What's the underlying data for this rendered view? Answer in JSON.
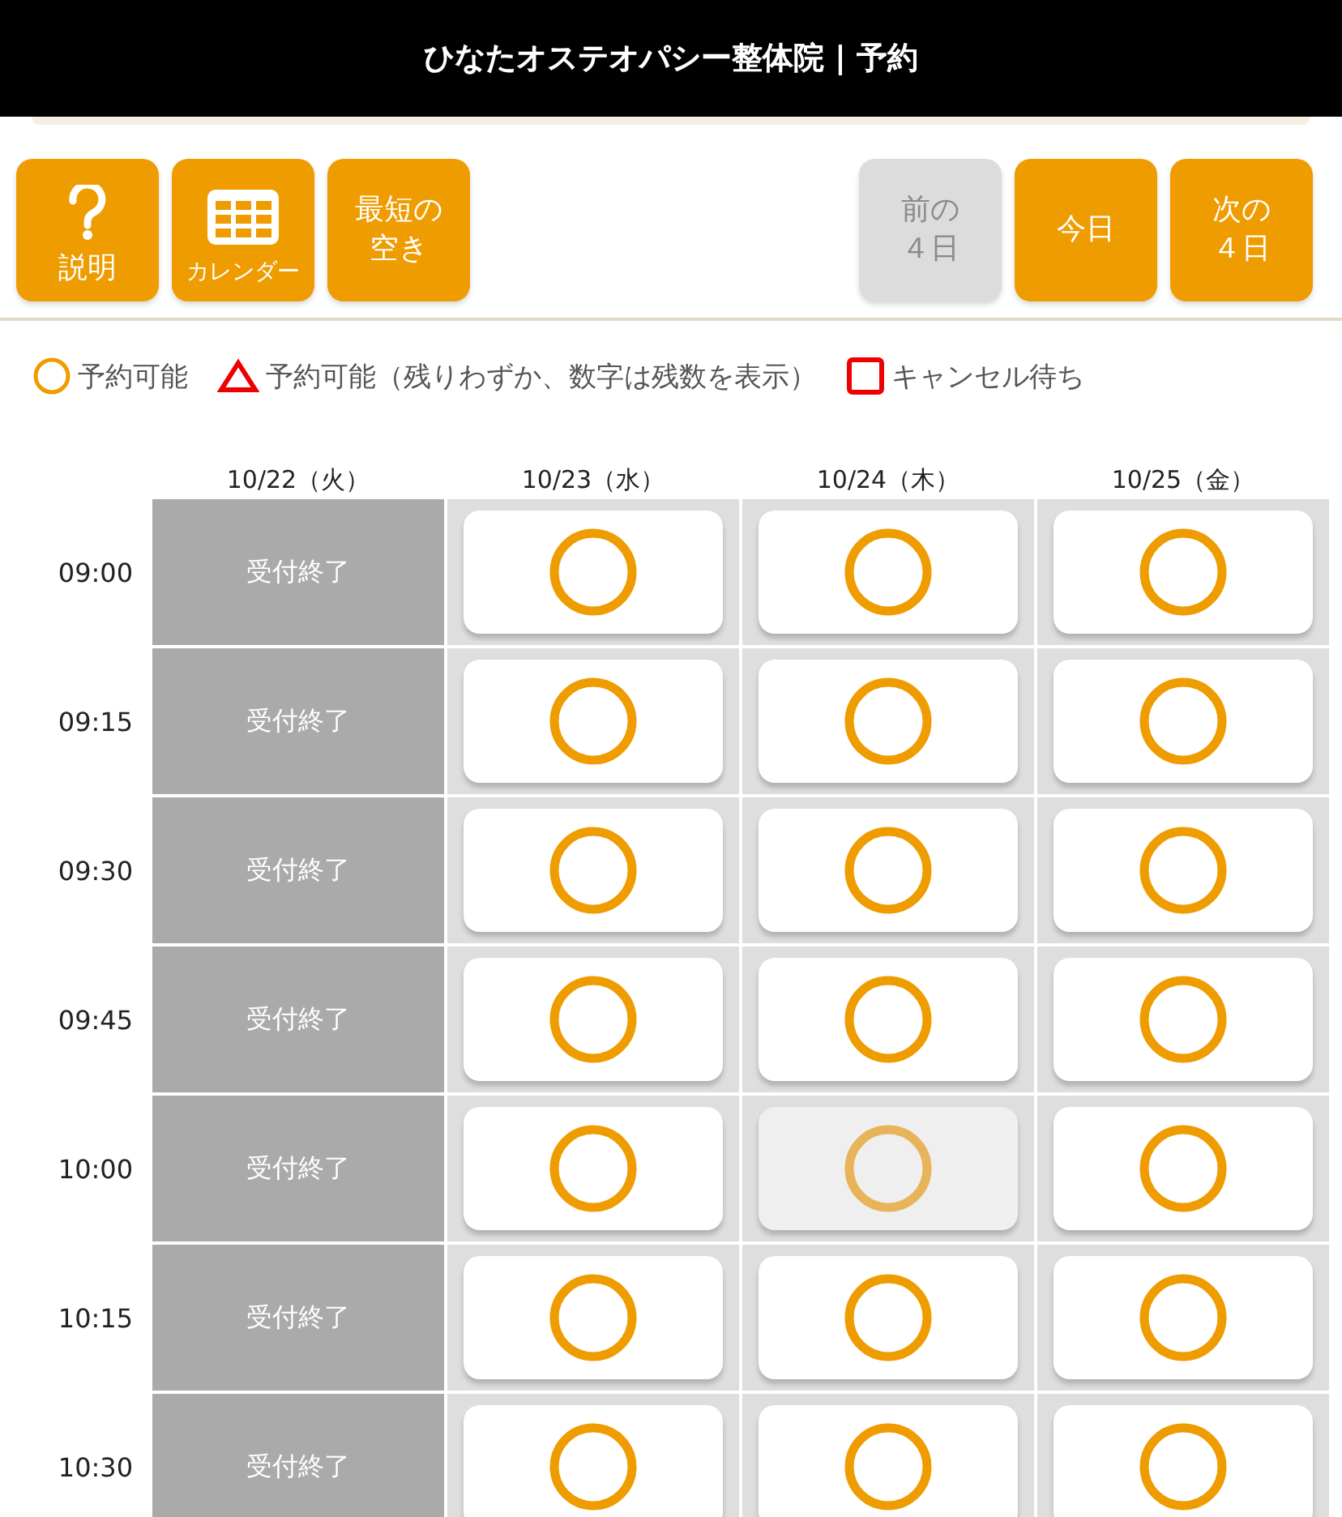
{
  "header": {
    "title": "ひなたオステオパシー整体院 | 予約"
  },
  "left_buttons": [
    {
      "kind": "help",
      "label": "説明",
      "disabled": false
    },
    {
      "kind": "calendar",
      "label": "カレンダー",
      "disabled": false
    },
    {
      "kind": "text",
      "label": "最短の空き",
      "disabled": false
    }
  ],
  "right_buttons": [
    {
      "kind": "text",
      "label": "前の４日",
      "disabled": true
    },
    {
      "kind": "text",
      "label": "今日",
      "disabled": false
    },
    {
      "kind": "text",
      "label": "次の４日",
      "disabled": false
    }
  ],
  "legend": [
    {
      "kind": "circle",
      "label": "予約可能"
    },
    {
      "kind": "triangle",
      "label": "予約可能（残りわずか、数字は残数を表示）"
    },
    {
      "kind": "square",
      "label": "キャンセル待ち"
    }
  ],
  "columns": [
    "10/22（火）",
    "10/23（水）",
    "10/24（木）",
    "10/25（金）"
  ],
  "rows": [
    {
      "time": "09:00",
      "cells": [
        {
          "kind": "closed",
          "text": "受付終了"
        },
        {
          "kind": "open",
          "selected": false
        },
        {
          "kind": "open",
          "selected": false
        },
        {
          "kind": "open",
          "selected": false
        }
      ]
    },
    {
      "time": "09:15",
      "cells": [
        {
          "kind": "closed",
          "text": "受付終了"
        },
        {
          "kind": "open",
          "selected": false
        },
        {
          "kind": "open",
          "selected": false
        },
        {
          "kind": "open",
          "selected": false
        }
      ]
    },
    {
      "time": "09:30",
      "cells": [
        {
          "kind": "closed",
          "text": "受付終了"
        },
        {
          "kind": "open",
          "selected": false
        },
        {
          "kind": "open",
          "selected": false
        },
        {
          "kind": "open",
          "selected": false
        }
      ]
    },
    {
      "time": "09:45",
      "cells": [
        {
          "kind": "closed",
          "text": "受付終了"
        },
        {
          "kind": "open",
          "selected": false
        },
        {
          "kind": "open",
          "selected": false
        },
        {
          "kind": "open",
          "selected": false
        }
      ]
    },
    {
      "time": "10:00",
      "cells": [
        {
          "kind": "closed",
          "text": "受付終了"
        },
        {
          "kind": "open",
          "selected": false
        },
        {
          "kind": "open",
          "selected": true
        },
        {
          "kind": "open",
          "selected": false
        }
      ]
    },
    {
      "time": "10:15",
      "cells": [
        {
          "kind": "closed",
          "text": "受付終了"
        },
        {
          "kind": "open",
          "selected": false
        },
        {
          "kind": "open",
          "selected": false
        },
        {
          "kind": "open",
          "selected": false
        }
      ]
    },
    {
      "time": "10:30",
      "cells": [
        {
          "kind": "closed",
          "text": "受付終了"
        },
        {
          "kind": "open",
          "selected": false
        },
        {
          "kind": "open",
          "selected": false
        },
        {
          "kind": "open",
          "selected": false
        }
      ]
    }
  ]
}
